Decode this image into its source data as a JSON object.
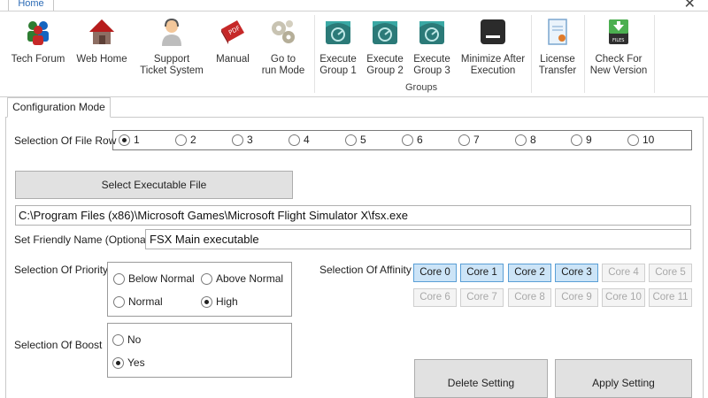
{
  "tab_bar": {
    "home_tab": "Home",
    "close_glyph": "✕"
  },
  "ribbon": {
    "buttons": [
      {
        "label": "Tech Forum",
        "icon": "users-icon"
      },
      {
        "label": "Web Home",
        "icon": "home-icon"
      },
      {
        "label": "Support\nTicket System",
        "icon": "support-person-icon"
      },
      {
        "label": "Manual",
        "icon": "pdf-manual-icon"
      },
      {
        "label": "Go to\nrun Mode",
        "icon": "gears-icon"
      },
      {
        "label": "Execute\nGroup 1",
        "icon": "execute-group-icon"
      },
      {
        "label": "Execute\nGroup 2",
        "icon": "execute-group-icon"
      },
      {
        "label": "Execute\nGroup 3",
        "icon": "execute-group-icon"
      },
      {
        "label": "Minimize After\nExecution",
        "icon": "minimize-window-icon"
      },
      {
        "label": "License\nTransfer",
        "icon": "license-certificate-icon"
      },
      {
        "label": "Check For\nNew Version",
        "icon": "download-file-icon"
      }
    ],
    "groups_label": "Groups"
  },
  "config_tab": "Configuration Mode",
  "file_row": {
    "label": "Selection Of File Row",
    "options": [
      "1",
      "2",
      "3",
      "4",
      "5",
      "6",
      "7",
      "8",
      "9",
      "10"
    ],
    "selected": "1"
  },
  "select_exe_button": "Select Executable File",
  "exe_path": "C:\\Program Files (x86)\\Microsoft Games\\Microsoft Flight Simulator X\\fsx.exe",
  "friendly_name": {
    "label": "Set Friendly Name (Optional)",
    "value": "FSX Main executable"
  },
  "priority": {
    "label": "Selection Of Priority",
    "options": [
      "Below Normal",
      "Above Normal",
      "Normal",
      "High"
    ],
    "selected": "High"
  },
  "boost": {
    "label": "Selection Of Boost",
    "options": [
      "No",
      "Yes"
    ],
    "selected": "Yes"
  },
  "affinity": {
    "label": "Selection Of Affinity",
    "cores": [
      {
        "label": "Core 0",
        "enabled": true
      },
      {
        "label": "Core 1",
        "enabled": true
      },
      {
        "label": "Core 2",
        "enabled": true
      },
      {
        "label": "Core 3",
        "enabled": true
      },
      {
        "label": "Core 4",
        "enabled": false
      },
      {
        "label": "Core 5",
        "enabled": false
      },
      {
        "label": "Core 6",
        "enabled": false
      },
      {
        "label": "Core 7",
        "enabled": false
      },
      {
        "label": "Core 8",
        "enabled": false
      },
      {
        "label": "Core 9",
        "enabled": false
      },
      {
        "label": "Core 10",
        "enabled": false
      },
      {
        "label": "Core 11",
        "enabled": false
      }
    ]
  },
  "actions": {
    "delete": "Delete Setting",
    "apply": "Apply Setting"
  },
  "colors": {
    "accent": "#2a6ab5",
    "core_selected_bg": "#cce4f7",
    "core_selected_border": "#5a9fd6"
  }
}
